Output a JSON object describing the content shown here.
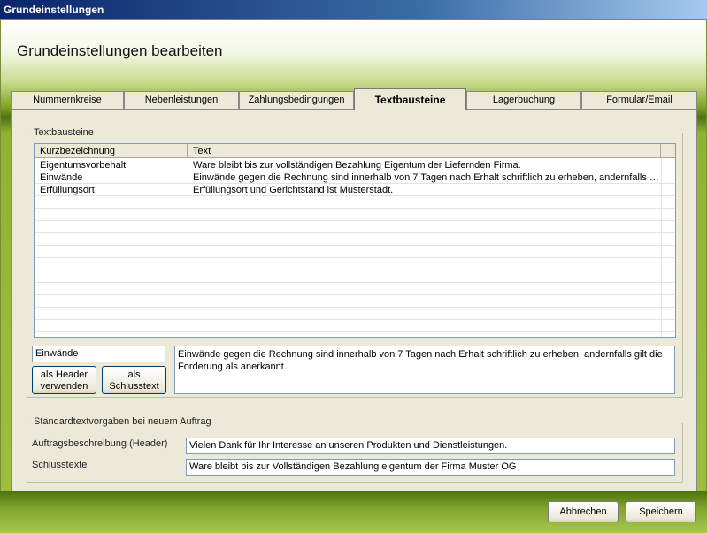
{
  "window": {
    "title": "Grundeinstellungen"
  },
  "header": {
    "title": "Grundeinstellungen bearbeiten"
  },
  "tabs": [
    {
      "label": "Nummernkreise"
    },
    {
      "label": "Nebenleistungen"
    },
    {
      "label": "Zahlungsbedingungen"
    },
    {
      "label": "Textbausteine"
    },
    {
      "label": "Lagerbuchung"
    },
    {
      "label": "Formular/Email"
    }
  ],
  "active_tab": "Textbausteine",
  "textbausteine": {
    "group_label": "Textbausteine",
    "columns": [
      "Kurzbezeichnung",
      "Text"
    ],
    "rows": [
      {
        "kurz": "Eigentumsvorbehalt",
        "text": "Ware bleibt bis zur vollständigen Bezahlung Eigentum der Liefernden Firma."
      },
      {
        "kurz": "Einwände",
        "text": "Einwände gegen die Rechnung sind innerhalb von 7 Tagen nach Erhalt schriftlich zu erheben, andernfalls gil..."
      },
      {
        "kurz": "Erfüllungsort",
        "text": "Erfüllungsort und Gerichtstand ist Musterstadt."
      }
    ],
    "edit_name_value": "Einwände",
    "edit_text_value": "Einwände gegen die Rechnung sind innerhalb von 7 Tagen nach Erhalt schriftlich zu erheben, andernfalls gilt die Forderung als anerkannt.",
    "btn_header_line1": "als Header",
    "btn_header_line2": "verwenden",
    "btn_schluss_line1": "als",
    "btn_schluss_line2": "Schlusstext"
  },
  "standard": {
    "group_label": "Standardtextvorgaben bei neuem Auftrag",
    "header_label": "Auftragsbeschreibung (Header)",
    "header_value": "Vielen Dank für Ihr Interesse an unseren Produkten und Dienstleistungen.",
    "schluss_label": "Schlusstexte",
    "schluss_value": "Ware bleibt bis zur Vollständigen Bezahlung eigentum der Firma Muster OG"
  },
  "footer": {
    "cancel_label": "Abbrechen",
    "save_label": "Speichern"
  },
  "colors": {
    "accent_green": "#7fa321",
    "title_blue": "#0a246a",
    "panel_bg": "#ece9d8"
  }
}
